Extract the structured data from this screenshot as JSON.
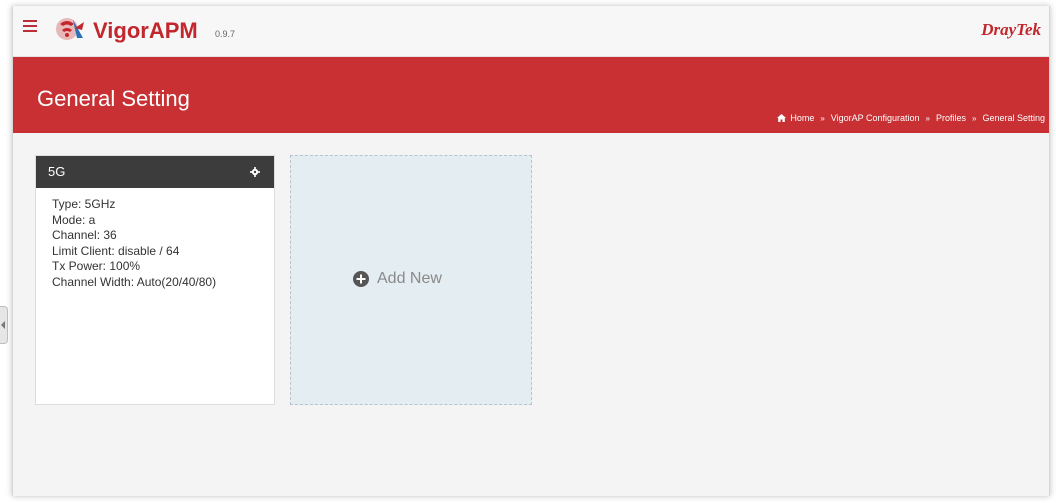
{
  "app": {
    "name": "VigorAPM",
    "version": "0.9.7",
    "brand": "DrayTek"
  },
  "page": {
    "title": "General Setting"
  },
  "breadcrumb": {
    "items": [
      "Home",
      "VigorAP Configuration",
      "Profiles",
      "General Setting"
    ],
    "separator": "»"
  },
  "profile": {
    "name": "5G",
    "fields": [
      "Type: 5GHz",
      "Mode: a",
      "Channel: 36",
      "Limit Client: disable / 64",
      "Tx Power: 100%",
      "Channel Width: Auto(20/40/80)"
    ]
  },
  "add_new": {
    "label": "Add New"
  },
  "colors": {
    "accent": "#c83034",
    "card_header": "#3c3c3c",
    "add_new_bg": "#e4edf2"
  },
  "icons": {
    "menu": "hamburger-icon",
    "logo": "vigorapm-logo-icon",
    "home": "home-icon",
    "settings": "gear-icon",
    "add": "plus-circle-icon"
  }
}
